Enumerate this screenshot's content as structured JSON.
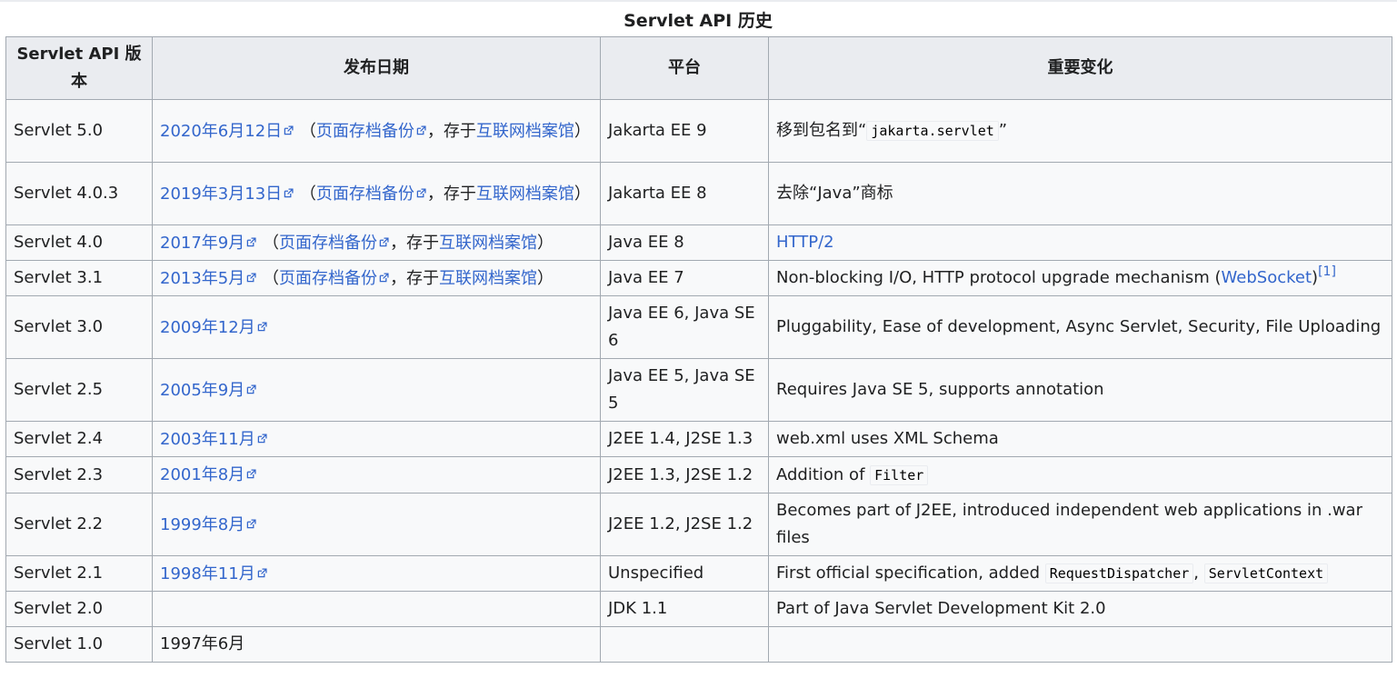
{
  "caption": "Servlet API 历史",
  "headers": {
    "version": "Servlet API 版本",
    "date": "发布日期",
    "platform": "平台",
    "changes": "重要变化"
  },
  "archive": {
    "open_paren": "（",
    "archived_label": "页面存档备份",
    "separator": "，存于",
    "archive_site": "互联网档案馆",
    "close_paren": "）"
  },
  "rows": [
    {
      "version": "Servlet 5.0",
      "date": "2020年6月12日",
      "platform": "Jakarta EE 9",
      "changes_prefix": "移到包名到“",
      "changes_code": "jakarta.servlet",
      "changes_suffix": "”"
    },
    {
      "version": "Servlet 4.0.3",
      "date": "2019年3月13日",
      "platform": "Jakarta EE 8",
      "changes": "去除“Java”商标"
    },
    {
      "version": "Servlet 4.0",
      "date": "2017年9月",
      "platform": "Java EE 8",
      "changes_link": "HTTP/2"
    },
    {
      "version": "Servlet 3.1",
      "date": "2013年5月",
      "platform": "Java EE 7",
      "changes_prefix": "Non-blocking I/O, HTTP protocol upgrade mechanism (",
      "changes_link": "WebSocket",
      "changes_suffix": ")",
      "ref": "[1]"
    },
    {
      "version": "Servlet 3.0",
      "date": "2009年12月",
      "platform": "Java EE 6, Java SE 6",
      "changes": "Pluggability, Ease of development, Async Servlet, Security, File Uploading"
    },
    {
      "version": "Servlet 2.5",
      "date": "2005年9月",
      "platform": "Java EE 5, Java SE 5",
      "changes": "Requires Java SE 5, supports annotation"
    },
    {
      "version": "Servlet 2.4",
      "date": "2003年11月",
      "platform": "J2EE 1.4, J2SE 1.3",
      "changes": "web.xml uses XML Schema"
    },
    {
      "version": "Servlet 2.3",
      "date": "2001年8月",
      "platform": "J2EE 1.3, J2SE 1.2",
      "changes_prefix": "Addition of ",
      "changes_code": "Filter"
    },
    {
      "version": "Servlet 2.2",
      "date": "1999年8月",
      "platform": "J2EE 1.2, J2SE 1.2",
      "changes": "Becomes part of J2EE, introduced independent web applications in .war files"
    },
    {
      "version": "Servlet 2.1",
      "date": "1998年11月",
      "platform": "Unspecified",
      "changes_prefix": "First official specification, added ",
      "changes_code": "RequestDispatcher",
      "changes_sep": ", ",
      "changes_code2": "ServletContext"
    },
    {
      "version": "Servlet 2.0",
      "date": "",
      "platform": "JDK 1.1",
      "changes": "Part of Java Servlet Development Kit 2.0"
    },
    {
      "version": "Servlet 1.0",
      "date_plain": "1997年6月",
      "platform": "",
      "changes": ""
    }
  ],
  "colors": {
    "link": "#3366cc",
    "header_bg": "#eaecf0",
    "cell_bg": "#f8f9fa",
    "border": "#a2a9b1"
  },
  "icons": {
    "external_link": "external-link-icon"
  }
}
